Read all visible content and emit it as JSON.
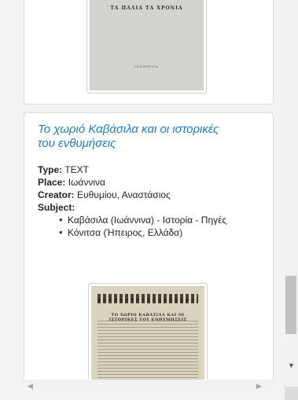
{
  "previous_item": {
    "cover_title": "ΤΑ ΠΑΛΙΑ ΤΑ ΧΡΟΝΙΑ",
    "cover_publisher": "ΙΩΑΝΝΙΝΑ"
  },
  "item": {
    "title": "Το χωριό Καβάσιλα και οι ιστορικές του ενθυμήσεις",
    "fields": {
      "type_label": "Type:",
      "type_value": "TEXT",
      "place_label": "Place:",
      "place_value": "Ιωάννινα",
      "creator_label": "Creator:",
      "creator_value": "Ευθυμίου, Αναστάσιος",
      "subject_label": "Subject:"
    },
    "subjects": [
      "Καβάσιλα (Ιωάννινα) - Ιστορία - Πηγές",
      "Κόνιτσα (Ήπειρος, Ελλάδα)"
    ],
    "thumbnail_heading": "ΤΟ ΧΩΡΙΟ ΚΑΒΑΣΙΛΑ ΚΑΙ ΟΙ ΙΣΤΟΡΙΚΕΣ ΤΟΥ ΕΝΘΥΜΗΣΕΙΣ"
  },
  "scrollbar": {
    "down_arrow": "▼",
    "left_arrow": "◀",
    "right_arrow": "▶"
  },
  "colors": {
    "link": "#1f7bc1",
    "background": "#f2f2f2"
  }
}
